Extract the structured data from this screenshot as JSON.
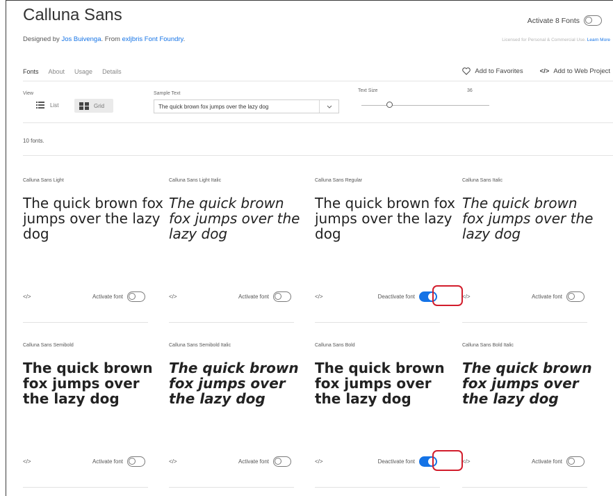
{
  "family": {
    "title": "Calluna Sans",
    "byline_prefix": "Designed by",
    "designer": "Jos Buivenga",
    "mid": ". From",
    "foundry": "exljbris Font Foundry",
    "end": "."
  },
  "activate_all": {
    "label": "Activate 8 Fonts",
    "on": false
  },
  "license": {
    "text": "Licensed for Personal & Commercial Use.",
    "link": "Learn More"
  },
  "tabs": [
    "Fonts",
    "About",
    "Usage",
    "Details"
  ],
  "actions": {
    "favorites": "Add to Favorites",
    "web_project": "Add to Web Project"
  },
  "controls": {
    "view_label": "View",
    "view_list": "List",
    "view_grid": "Grid",
    "sample_label": "Sample Text",
    "sample_value": "The quick brown fox jumps over the lazy dog",
    "size_label": "Text Size",
    "size_value": "36",
    "size_level": 0.22
  },
  "count": "10 fonts.",
  "sample_text": "The quick brown fox jumps over the lazy dog",
  "code_label": "</>",
  "fonts": [
    {
      "name": "Calluna Sans Light",
      "action": "Activate font",
      "active": false
    },
    {
      "name": "Calluna Sans Light Italic",
      "action": "Activate font",
      "active": false
    },
    {
      "name": "Calluna Sans Regular",
      "action": "Deactivate font",
      "active": true
    },
    {
      "name": "Calluna Sans Italic",
      "action": "Activate font",
      "active": false
    },
    {
      "name": "Calluna Sans Semibold",
      "action": "Activate font",
      "active": false
    },
    {
      "name": "Calluna Sans Semibold Italic",
      "action": "Activate font",
      "active": false
    },
    {
      "name": "Calluna Sans Bold",
      "action": "Deactivate font",
      "active": true
    },
    {
      "name": "Calluna Sans Bold Italic",
      "action": "Activate font",
      "active": false
    }
  ],
  "colors": {
    "accent": "#1473e6",
    "highlight": "#d21d2c"
  }
}
